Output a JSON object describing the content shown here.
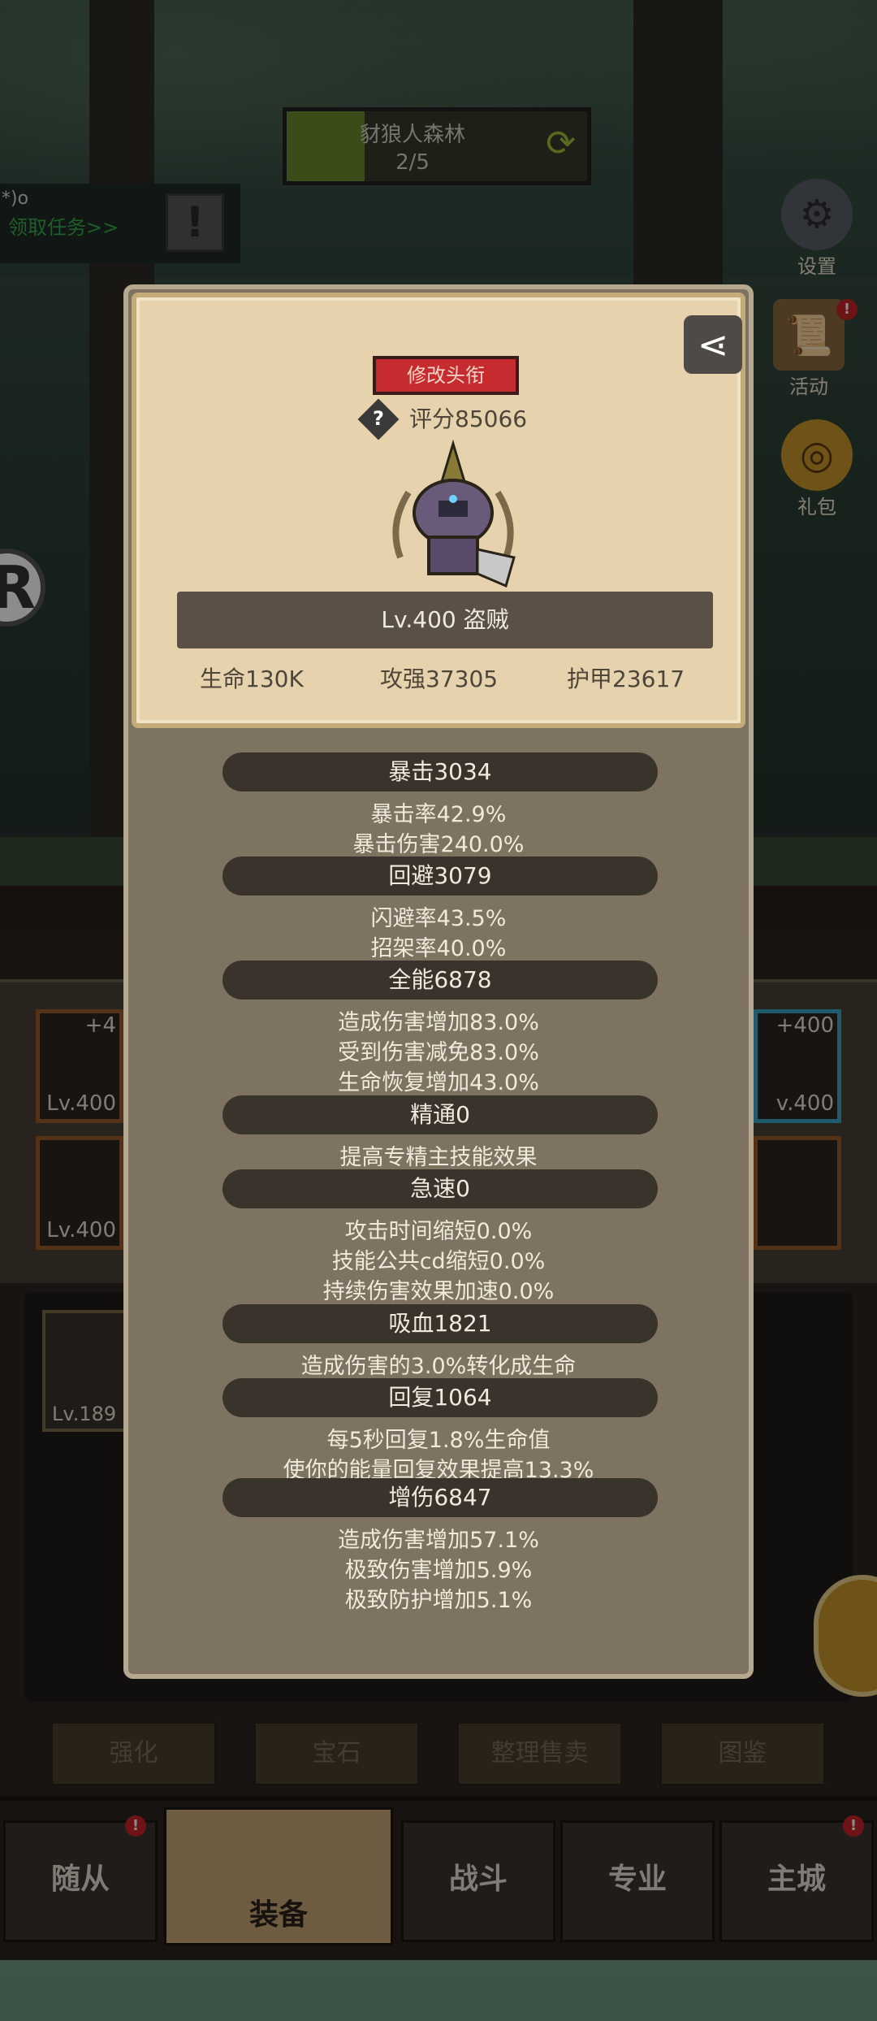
{
  "stage": {
    "name": "豺狼人森林",
    "progress": "2/5"
  },
  "quest": {
    "prefix": "*)o",
    "link": "领取任务>>",
    "icon": "!"
  },
  "side_buttons": [
    {
      "label": "设置",
      "icon": "gear-icon"
    },
    {
      "label": "活动",
      "icon": "scroll-icon"
    },
    {
      "label": "礼包",
      "icon": "gift-icon"
    }
  ],
  "left_badge": "R",
  "equip_slots": [
    {
      "plus": "+4",
      "level": "Lv.400"
    },
    {
      "plus": "",
      "level": "Lv.400"
    },
    {
      "plus": "+400",
      "level": "v.400"
    }
  ],
  "inventory_item_level": "Lv.189",
  "action_buttons": [
    "强化",
    "宝石",
    "整理售卖",
    "图鉴"
  ],
  "nav_tabs": [
    "随从",
    "装备",
    "战斗",
    "专业",
    "主城"
  ],
  "profile": {
    "title_button": "修改头衔",
    "help": "?",
    "score": "评分85066",
    "level_class": "Lv.400 盗贼",
    "hp": "生命130K",
    "attack": "攻强37305",
    "armor": "护甲23617"
  },
  "stats": [
    {
      "header": "暴击3034",
      "lines": [
        "暴击率42.9%",
        "暴击伤害240.0%"
      ]
    },
    {
      "header": "回避3079",
      "lines": [
        "闪避率43.5%",
        "招架率40.0%"
      ]
    },
    {
      "header": "全能6878",
      "lines": [
        "造成伤害增加83.0%",
        "受到伤害减免83.0%",
        "生命恢复增加43.0%"
      ]
    },
    {
      "header": "精通0",
      "lines": [
        "提高专精主技能效果"
      ]
    },
    {
      "header": "急速0",
      "lines": [
        "攻击时间缩短0.0%",
        "技能公共cd缩短0.0%",
        "持续伤害效果加速0.0%"
      ]
    },
    {
      "header": "吸血1821",
      "lines": [
        "造成伤害的3.0%转化成生命"
      ]
    },
    {
      "header": "回复1064",
      "lines": [
        "每5秒回复1.8%生命值",
        "使你的能量回复效果提高13.3%"
      ]
    },
    {
      "header": "增伤6847",
      "lines": [
        "造成伤害增加57.1%",
        "极致伤害增加5.9%",
        "极致防护增加5.1%"
      ]
    }
  ],
  "colors": {
    "title_button": "#c62c2f",
    "card": "#e6d3ad",
    "modal": "#7e7260"
  }
}
